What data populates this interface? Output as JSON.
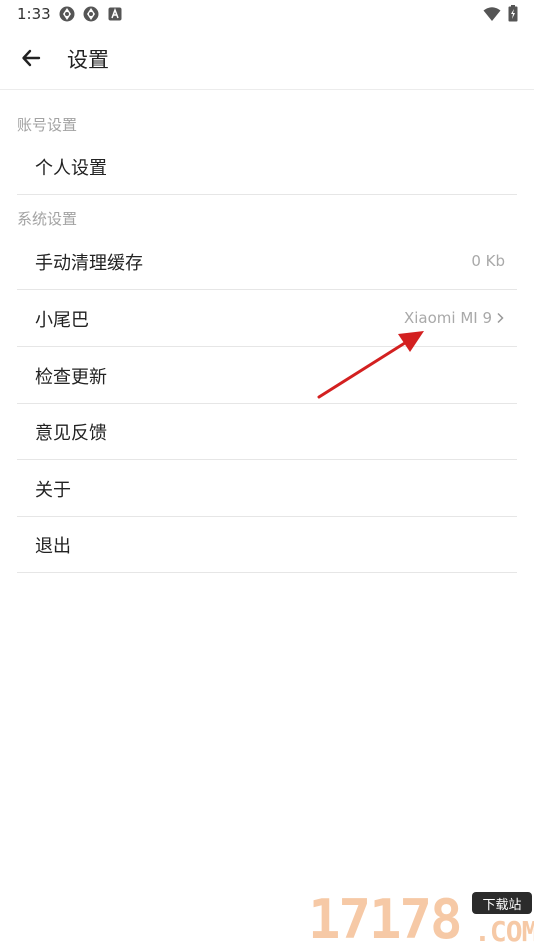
{
  "status_bar": {
    "time": "1:33",
    "icons": [
      "app-badge-icon",
      "app-badge-icon",
      "android-a-icon",
      "wifi-icon",
      "battery-icon"
    ]
  },
  "app_bar": {
    "title": "设置",
    "back_icon": "arrow-left-icon"
  },
  "sections": {
    "account": {
      "header": "账号设置",
      "items": [
        {
          "label": "个人设置"
        }
      ]
    },
    "system": {
      "header": "系统设置",
      "items": [
        {
          "label": "手动清理缓存",
          "value": "0 Kb"
        },
        {
          "label": "小尾巴",
          "value": "Xiaomi MI 9"
        },
        {
          "label": "检查更新"
        },
        {
          "label": "意见反馈"
        },
        {
          "label": "关于"
        },
        {
          "label": "退出"
        }
      ]
    }
  },
  "watermark": {
    "badge": "下载站",
    "number": "17178",
    "suffix": ".COM"
  },
  "colors": {
    "annotation_arrow": "#d32020",
    "header_text": "#a3a3a3",
    "value_text": "#a9a9a9",
    "divider": "#e6e6e6"
  }
}
